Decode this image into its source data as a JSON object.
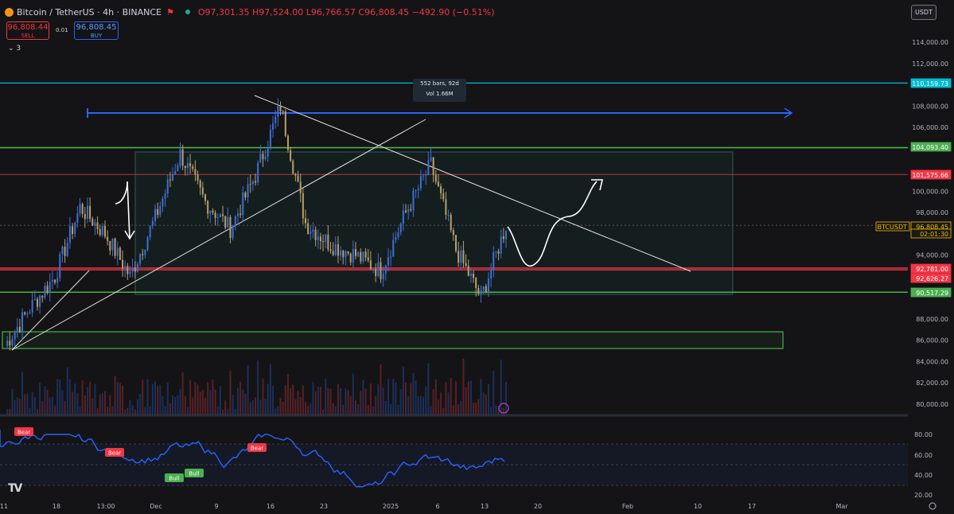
{
  "header": {
    "symbol_title": "Bitcoin / TetherUS · 4h · BINANCE",
    "ohlc": {
      "open": "O97,301.35",
      "high": "H97,524.00",
      "low": "L96,766.57",
      "close": "C96,808.45",
      "change": "−492.90 (−0.51%)"
    }
  },
  "trade": {
    "sell_price": "96,808.44",
    "sell_label": "SELL",
    "spread": "0.01",
    "buy_price": "96,808.45",
    "buy_label": "BUY"
  },
  "indicators_toggle": "3",
  "currency": "USDT",
  "price_axis": [
    "114,000.00",
    "112,000.00",
    "108,000.00",
    "106,000.00",
    "100,000.00",
    "98,000.00",
    "94,000.00",
    "88,000.00",
    "86,000.00",
    "84,000.00",
    "82,000.00",
    "80,000.00"
  ],
  "price_tags": [
    {
      "label": "110,159.73",
      "color": "#00bcd4",
      "price": 110159.73
    },
    {
      "label": "104,093.40",
      "color": "#4caf50",
      "price": 104093.4
    },
    {
      "label": "101,575.66",
      "color": "#f23645",
      "price": 101575.66
    },
    {
      "label": "BTCUSDT",
      "color": "#f0b90b",
      "price": 96808.45
    },
    {
      "label": "96,808.45",
      "color": "#f0b90b",
      "price": 96808.45
    },
    {
      "label": "02:01:30",
      "color": "#f0b90b",
      "price": 96808.45
    },
    {
      "label": "92,781.00",
      "color": "#f23645",
      "price": 92781.0
    },
    {
      "label": "92,626.27",
      "color": "#f23645",
      "price": 92626.27
    },
    {
      "label": "90,517.29",
      "color": "#4caf50",
      "price": 90517.29
    }
  ],
  "measure_tool": {
    "bars": "552 bars, 92d",
    "volume": "Vol 1.66M"
  },
  "rsi_axis": [
    "80.00",
    "60.00",
    "40.00",
    "20.00"
  ],
  "rsi_signals": [
    {
      "label": "Bear",
      "type": "bear"
    },
    {
      "label": "Bear",
      "type": "bear"
    },
    {
      "label": "Bull",
      "type": "bull"
    },
    {
      "label": "Bull",
      "type": "bull"
    },
    {
      "label": "Bear",
      "type": "bear"
    }
  ],
  "time_axis": [
    "11",
    "18",
    "13:00",
    "Dec",
    "9",
    "16",
    "23",
    "2025",
    "6",
    "13",
    "20",
    "Feb",
    "10",
    "17",
    "Mar"
  ],
  "colors": {
    "up": "#26a69a",
    "down": "#f23645",
    "candle": "#b8a06a",
    "rsi": "#2962ff",
    "cyan": "#00bcd4",
    "green": "#4caf50",
    "red": "#f23645",
    "blue_ray": "#2962ff"
  },
  "chart_data": {
    "type": "candlestick",
    "instrument": "BTCUSDT",
    "timeframe": "4h",
    "ylim": [
      79000,
      115000
    ],
    "horizontal_levels": [
      110159.73,
      104093.4,
      101575.66,
      92781.0,
      92626.27,
      90517.29
    ],
    "approx_path": [
      {
        "t": "Nov 11",
        "p": 85500
      },
      {
        "t": "Nov 14",
        "p": 89000
      },
      {
        "t": "Nov 18",
        "p": 92000
      },
      {
        "t": "Nov 21",
        "p": 98500
      },
      {
        "t": "Nov 25",
        "p": 96000
      },
      {
        "t": "Nov 26",
        "p": 92000
      },
      {
        "t": "Nov 29",
        "p": 97500
      },
      {
        "t": "Dec 5",
        "p": 103500
      },
      {
        "t": "Dec 6",
        "p": 99000
      },
      {
        "t": "Dec 9",
        "p": 96500
      },
      {
        "t": "Dec 13",
        "p": 101500
      },
      {
        "t": "Dec 17",
        "p": 108000
      },
      {
        "t": "Dec 20",
        "p": 97000
      },
      {
        "t": "Dec 23",
        "p": 95000
      },
      {
        "t": "Dec 26",
        "p": 94000
      },
      {
        "t": "Dec 30",
        "p": 92500
      },
      {
        "t": "Jan 3",
        "p": 98000
      },
      {
        "t": "Jan 7",
        "p": 102500
      },
      {
        "t": "Jan 9",
        "p": 94500
      },
      {
        "t": "Jan 13",
        "p": 90000
      },
      {
        "t": "Jan 15",
        "p": 96800
      }
    ]
  }
}
